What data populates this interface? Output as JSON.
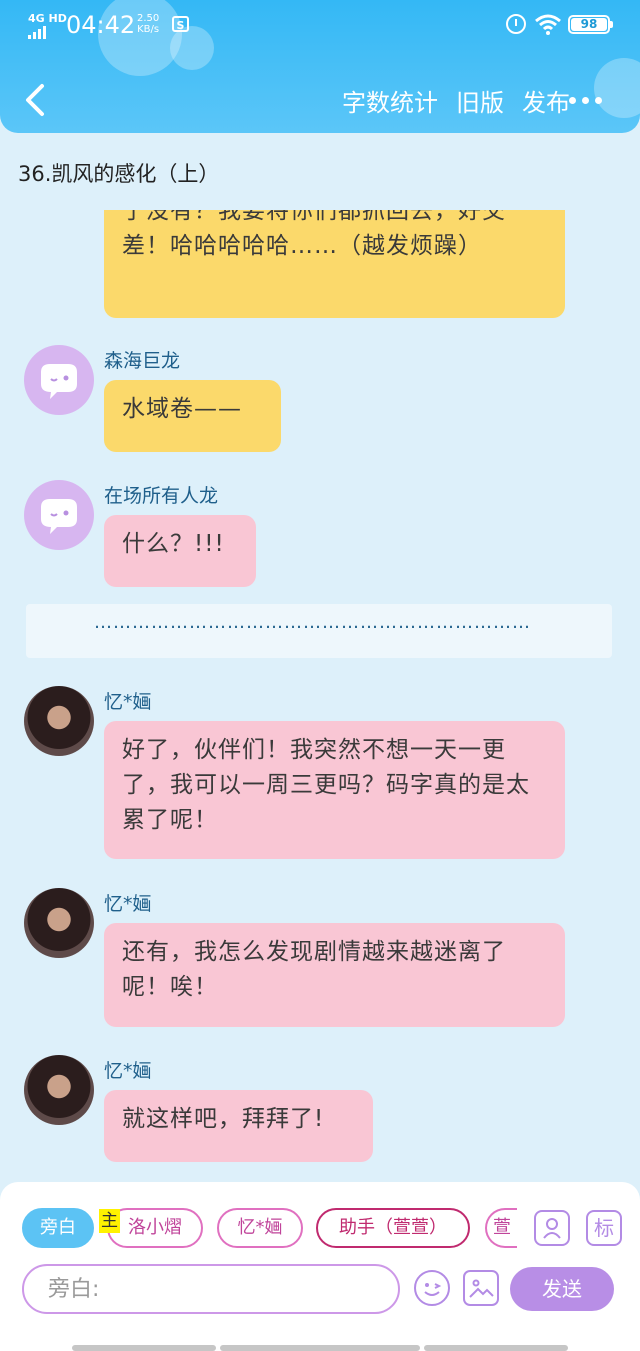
{
  "status_bar": {
    "network": "4G HD",
    "time": "04:42",
    "speed_value": "2.50",
    "speed_unit": "KB/s",
    "battery": "98"
  },
  "nav": {
    "actions": [
      "字数统计",
      "旧版",
      "发布"
    ]
  },
  "chapter_title": "36.凯风的感化（上）",
  "messages": [
    {
      "text": "了没有？我要将你们都抓回去，好交差！哈哈哈哈哈……（越发烦躁）"
    },
    {
      "sender": "森海巨龙",
      "text": "水域卷——"
    },
    {
      "sender": "在场所有人龙",
      "text": "什么？!!!"
    },
    {
      "divider": "……………………………………………………………"
    },
    {
      "sender": "忆*婳",
      "text": "好了，伙伴们！我突然不想一天一更了，我可以一周三更吗？码字真的是太累了呢！"
    },
    {
      "sender": "忆*婳",
      "text": "还有，我怎么发现剧情越来越迷离了呢！唉！"
    },
    {
      "sender": "忆*婳",
      "text": "就这样吧，拜拜了!"
    }
  ],
  "composer": {
    "roles": [
      "旁白",
      "洛小熠",
      "忆*婳",
      "助手（萱萱）",
      "萱"
    ],
    "host_badge": "主",
    "icon_label": "标",
    "placeholder": "旁白:",
    "send_label": "发送"
  },
  "colors": {
    "header": "#34b8f5",
    "background": "#ddf0fa",
    "bubble_yellow": "#fbd96b",
    "bubble_pink": "#f9c6d4",
    "send": "#b88ee6"
  }
}
